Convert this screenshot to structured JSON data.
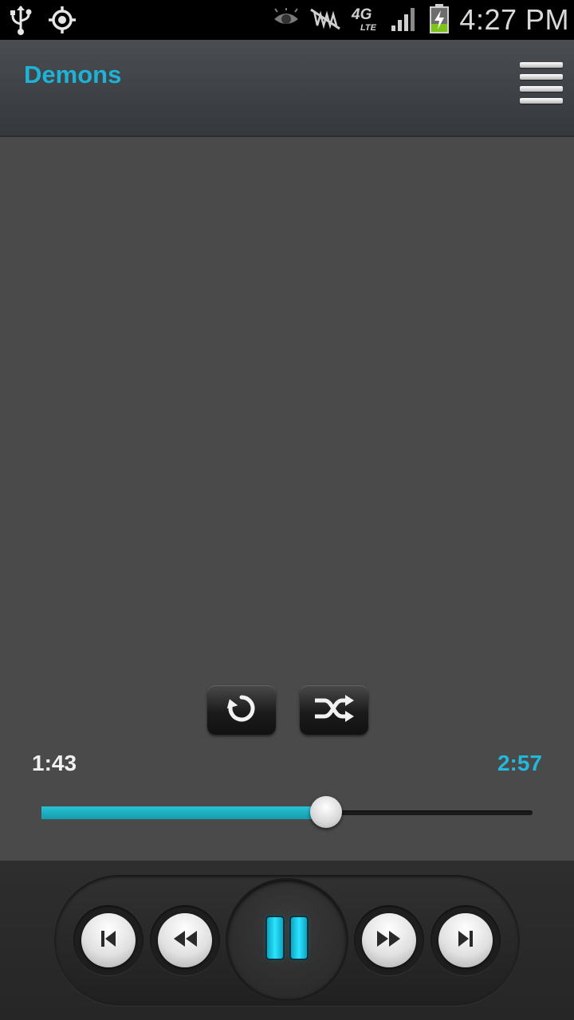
{
  "status_bar": {
    "time": "4:27 PM",
    "network": "4G LTE",
    "icons": [
      "usb-icon",
      "gps-icon",
      "eye-icon",
      "no-signal-icon",
      "lte-icon",
      "signal-icon",
      "battery-charging-icon"
    ]
  },
  "header": {
    "track_title": "Demons",
    "menu_icon": "menu-icon"
  },
  "controls": {
    "repeat_icon": "repeat-icon",
    "shuffle_icon": "shuffle-icon"
  },
  "progress": {
    "elapsed": "1:43",
    "total": "2:57",
    "fraction": 0.58
  },
  "transport": {
    "buttons": [
      "previous-icon",
      "rewind-icon",
      "pause-icon",
      "fast-forward-icon",
      "next-icon"
    ]
  },
  "colors": {
    "accent": "#22b7db",
    "background": "#4a4a4a",
    "seek_fill": "#1aa9bb"
  }
}
